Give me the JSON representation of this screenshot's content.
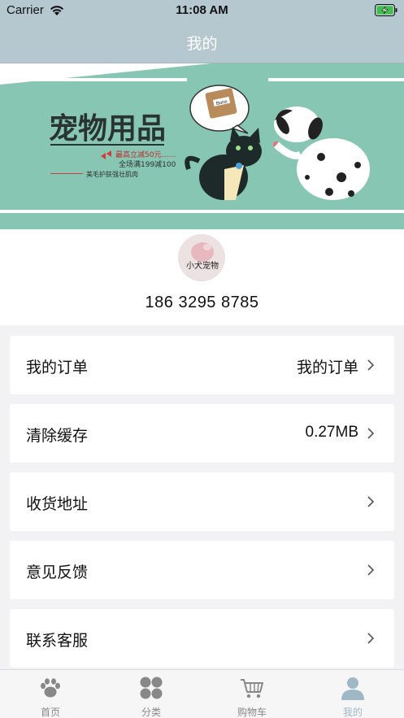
{
  "status_bar": {
    "carrier": "Carrier",
    "time": "11:08 AM"
  },
  "nav": {
    "title": "我的"
  },
  "banner": {
    "headline": "宠物用品",
    "promo_line1": "最高立减50元……",
    "promo_line2": "全场满199减100",
    "subline": "美毛护肤强壮肌肉",
    "bag_label": "Bone"
  },
  "profile": {
    "avatar_text": "小犬宠物",
    "phone": "186 3295 8785"
  },
  "menu": [
    {
      "label": "我的订单",
      "value": "我的订单"
    },
    {
      "label": "清除缓存",
      "value": "0.27MB"
    },
    {
      "label": "收货地址",
      "value": ""
    },
    {
      "label": "意见反馈",
      "value": ""
    },
    {
      "label": "联系客服",
      "value": ""
    }
  ],
  "tabs": [
    {
      "label": "首页",
      "icon": "paw-icon"
    },
    {
      "label": "分类",
      "icon": "grid-icon"
    },
    {
      "label": "购物车",
      "icon": "cart-icon"
    },
    {
      "label": "我的",
      "icon": "user-icon"
    }
  ],
  "colors": {
    "nav": "#b5c8d0",
    "banner_green": "#87c6b2",
    "active_tab": "#9fb8c6"
  }
}
